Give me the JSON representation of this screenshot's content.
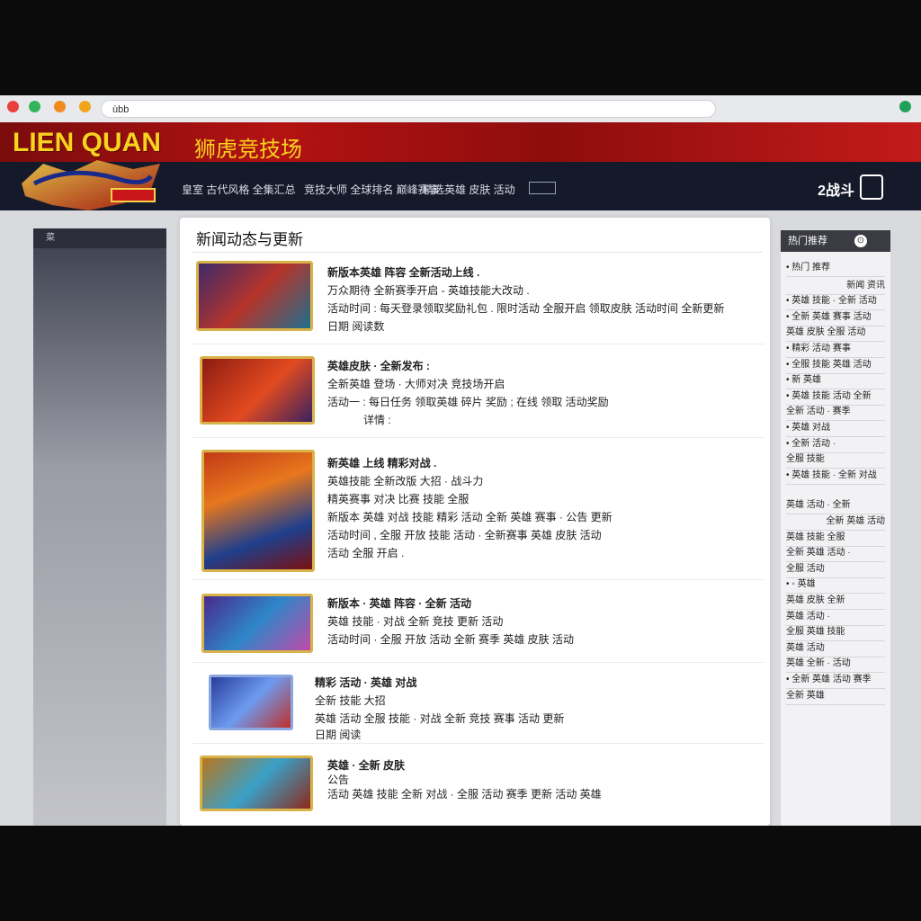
{
  "browser": {
    "url_text": "ùbb",
    "colors": {
      "close": "#e8413b",
      "green": "#35b35a",
      "orange": "#f08a1f",
      "yellow": "#f2a51a"
    }
  },
  "banner": {
    "title": "LIEN QUAN",
    "subtitle": "狮虎竞技场"
  },
  "nav": {
    "items": [
      "皇室 古代风格 全集汇总",
      "竞技大师 全球排名 巅峰赛事",
      "精选英雄 皮肤 活动"
    ],
    "right_text": "2战斗"
  },
  "left_sidebar": {
    "heading": "菜"
  },
  "main": {
    "title": "新闻动态与更新",
    "items": [
      {
        "lines": [
          "新版本英雄 阵容 全新活动上线 .",
          "万众期待 全新赛季开启 - 英雄技能大改动 .",
          "活动时间 : 每天登录领取奖励礼包 . 限时活动 全服开启 领取皮肤 活动时间 全新更新",
          "日期        阅读数"
        ]
      },
      {
        "lines": [
          "英雄皮肤 · 全新发布 :",
          "全新英雄 登场 · 大师对决 竞技场开启",
          "活动一 : 每日任务 领取英雄 碎片 奖励 ; 在线 领取 活动奖励",
          "详情 :"
        ]
      },
      {
        "lines": [
          "新英雄 上线 精彩对战 .",
          "英雄技能 全新改版 大招 · 战斗力",
          "精英赛事 对决 比赛 技能 全服",
          "新版本 英雄 对战 技能 精彩 活动 全新 英雄 赛事 · 公告 更新",
          "活动时间 , 全服 开放 技能 活动 · 全新赛事 英雄 皮肤 活动",
          "活动 全服 开启 ."
        ]
      },
      {
        "lines": [
          "新版本 · 英雄 阵容 · 全新 活动",
          "英雄 技能 · 对战 全新 竞技 更新 活动",
          "活动时间 · 全服 开放 活动 全新 赛季 英雄 皮肤 活动"
        ]
      },
      {
        "lines": [
          "精彩 活动 · 英雄 对战",
          "全新 技能 大招",
          "英雄 活动 全服 技能 · 对战 全新 竞技 赛事 活动 更新",
          "日期      阅读"
        ]
      },
      {
        "lines": [
          "英雄 · 全新 皮肤",
          "公告",
          "活动 英雄 技能 全新 对战 · 全服 活动 赛季 更新 活动 英雄"
        ]
      }
    ]
  },
  "right_sidebar": {
    "heading": "热门推荐",
    "heading_icon": "⊙",
    "rows": [
      "• 热门 推荐",
      "新闻 资讯",
      "• 英雄 技能 · 全新 活动",
      "• 全新 英雄 赛事 活动",
      "英雄 皮肤 全服 活动",
      "• 精彩 活动 赛事",
      "• 全服 技能 英雄 活动",
      "• 新 英雄",
      "• 英雄 技能 活动 全新",
      "全新 活动 · 赛季",
      "• 英雄 对战",
      "• 全新 活动 ·",
      "全服 技能",
      "• 英雄 技能 · 全新 对战",
      "英雄 活动 · 全新",
      "全新 英雄 活动",
      "英雄 技能 全服",
      "全新 英雄 活动 ·",
      "全服 活动",
      "• ◦ 英雄",
      "英雄 皮肤 全新",
      "英雄 活动 ·",
      "全服 英雄 技能",
      "英雄 活动",
      "英雄 全新 · 活动",
      "• 全新 英雄 活动 赛季",
      "全新 英雄"
    ]
  }
}
